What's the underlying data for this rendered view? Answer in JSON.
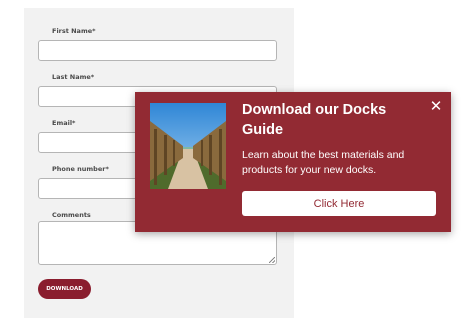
{
  "form": {
    "first_name_label": "First Name*",
    "last_name_label": "Last Name*",
    "email_label": "Email*",
    "phone_label": "Phone number*",
    "comments_label": "Comments",
    "submit_label": "DOWNLOAD"
  },
  "popup": {
    "title_line1": "Download our Docks",
    "title_line2": "Guide",
    "description_line1": "Learn about the best materials and",
    "description_line2": "products for your new docks.",
    "cta_label": "Click Here",
    "close_icon": "close-icon",
    "image_icon": "boardwalk-photo"
  },
  "colors": {
    "popup_bg": "#922a33",
    "download_button": "#8a1d2e",
    "form_bg": "#f2f2f2"
  }
}
